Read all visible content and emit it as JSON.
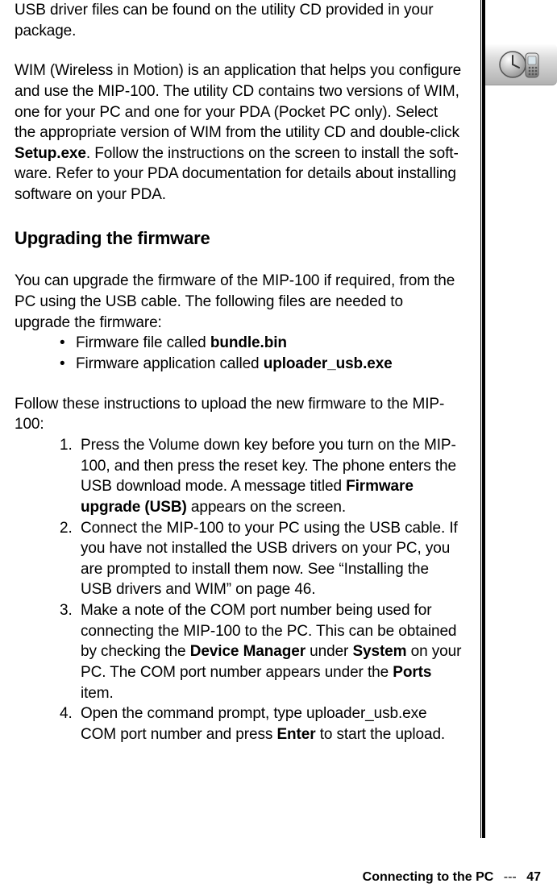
{
  "paragraphs": {
    "p1": "USB driver files can be found on the utility CD provided in your package.",
    "p2_prefix": "WIM (Wireless in Motion) is an application that helps you configure and use the MIP-100. The utility CD contains two versions of WIM, one for your PC and one for your PDA (Pocket PC only). Select the appropriate version of WIM from the utility CD and double-click ",
    "p2_bold": "Setup.exe",
    "p2_suffix": ". Fol­low the instructions on the screen to install the soft­ware. Refer to your PDA documentation for details about installing software on your PDA."
  },
  "heading": "Upgrading the firmware",
  "upgrade_intro": "You can upgrade the firmware of the MIP-100 if required, from the PC using the USB cable. The follow­ing files are needed to upgrade the firmware:",
  "bullets": {
    "b1_prefix": "Firmware file called ",
    "b1_bold": "bundle.bin",
    "b2_prefix": "Firmware application called ",
    "b2_bold": "uploader_usb.exe"
  },
  "steps_intro": "Follow these instructions to upload the new firmware to the MIP-100:",
  "steps": {
    "s1_prefix": "Press the Volume down key before you turn on the MIP-100, and then press the reset key. The phone enters the USB download mode. A message titled ",
    "s1_bold": "Firmware upgrade (USB)",
    "s1_suffix": " appears on the screen.",
    "s2": "Connect the MIP-100 to your PC using the USB cable. If you have not installed the USB drivers on your PC, you are prompted to install them now. See “Installing the USB drivers and WIM” on page 46.",
    "s3_prefix": "Make a note of the COM port number being used for connecting the MIP-100 to the PC. This can be obtained by checking the ",
    "s3_b1": "Device Manager",
    "s3_mid1": " under ",
    "s3_b2": "System",
    "s3_mid2": " on your PC. The COM port number appears under the ",
    "s3_b3": "Ports",
    "s3_suffix": " item.",
    "s4_prefix": "Open the command prompt, type uploader_usb.exe COM port number and press ",
    "s4_bold": "Enter",
    "s4_suffix": " to start the upload."
  },
  "footer": {
    "title": "Connecting to the PC",
    "separator": "---",
    "page": "47"
  },
  "tab_icon": "clock-phone-icon"
}
